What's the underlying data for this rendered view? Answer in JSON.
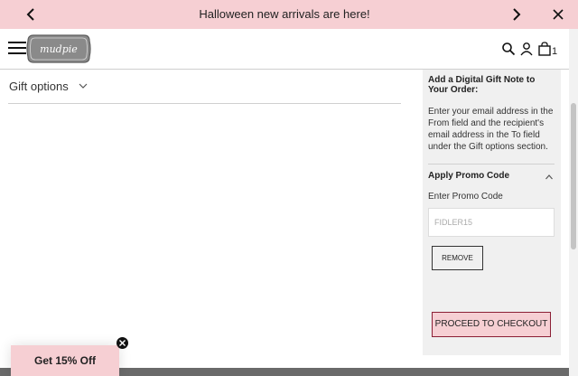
{
  "announcement": {
    "message": "Halloween new arrivals are here!",
    "background": "#f6cfd3"
  },
  "header": {
    "logo_text": "mudpie",
    "cart_count": "1"
  },
  "main": {
    "gift_options_label": "Gift options"
  },
  "sidebar": {
    "gift_note_title": "Add a Digital Gift Note to Your Order:",
    "gift_note_body": "Enter your email address in the From field and the recipient's email address in the To field under the Gift options section.",
    "promo_header": "Apply Promo Code",
    "promo_label": "Enter Promo Code",
    "promo_value": "FIDLER15",
    "remove_label": "REMOVE",
    "checkout_label": "PROCEED TO CHECKOUT"
  },
  "popup": {
    "discount_label": "Get 15% Off"
  },
  "colors": {
    "accent_pink": "#f6cfd3",
    "checkout_border": "#8b1f35",
    "sidebar_bg": "#f0f0f0"
  },
  "icons": [
    "chevron-left-icon",
    "chevron-right-icon",
    "close-icon",
    "hamburger-icon",
    "search-icon",
    "account-icon",
    "bag-icon",
    "chevron-down-icon",
    "chevron-up-icon"
  ]
}
